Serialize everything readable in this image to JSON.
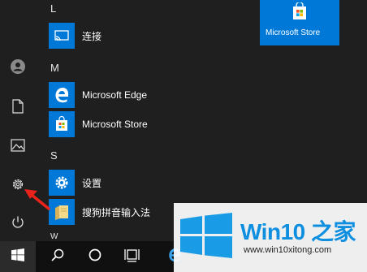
{
  "applist": {
    "sections": [
      {
        "letter": "L"
      },
      {
        "letter": "M"
      },
      {
        "letter": "S"
      },
      {
        "letter": "W"
      }
    ],
    "apps": [
      {
        "label": "连接",
        "icon": "connect-icon"
      },
      {
        "label": "Microsoft Edge",
        "icon": "edge-icon"
      },
      {
        "label": "Microsoft Store",
        "icon": "store-icon"
      },
      {
        "label": "设置",
        "icon": "gear-icon"
      },
      {
        "label": "搜狗拼音输入法",
        "icon": "folder-icon"
      }
    ]
  },
  "rail": {
    "items": [
      {
        "icon": "user-avatar-icon"
      },
      {
        "icon": "document-icon"
      },
      {
        "icon": "pictures-icon"
      },
      {
        "icon": "settings-gear-icon"
      },
      {
        "icon": "power-icon"
      }
    ]
  },
  "tiles": {
    "store": {
      "label": "Microsoft Store"
    }
  },
  "taskbar": {
    "items": [
      "start-windows-icon",
      "search-icon",
      "cortana-icon",
      "task-view-icon",
      "edge-icon"
    ]
  },
  "watermark": {
    "title": "Win10 之家",
    "url": "www.win10xitong.com"
  },
  "colors": {
    "accent": "#0078d7",
    "menu_bg": "#1f1f1f",
    "taskbar_bg": "#101010",
    "arrow": "#e8231a",
    "watermark_blue": "#0f8fe0"
  }
}
